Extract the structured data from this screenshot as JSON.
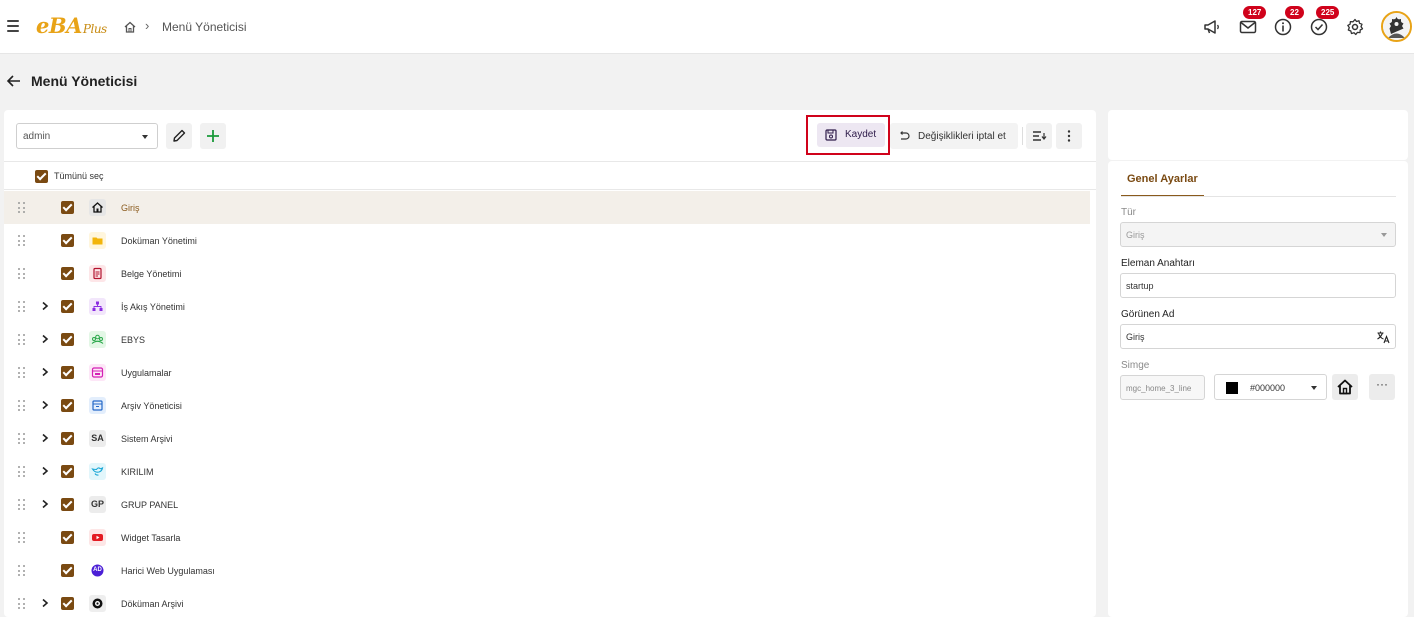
{
  "topbar": {
    "logo_text": "eBA",
    "logo_plus": "Plus",
    "breadcrumb": "Menü Yöneticisi",
    "badges": {
      "mail": "127",
      "info": "22",
      "tasks": "225"
    }
  },
  "page": {
    "title": "Menü Yöneticisi"
  },
  "toolbar": {
    "user_select": "admin",
    "save_label": "Kaydet",
    "cancel_label": "Değişiklikleri iptal et"
  },
  "tree": {
    "select_all_label": "Tümünü seç",
    "items": [
      {
        "label": "Giriş",
        "icon": "home-icon",
        "expandable": false,
        "selected": true
      },
      {
        "label": "Doküman Yönetimi",
        "icon": "folder-icon",
        "expandable": false
      },
      {
        "label": "Belge Yönetimi",
        "icon": "document-icon",
        "expandable": false
      },
      {
        "label": "İş Akış Yönetimi",
        "icon": "workflow-icon",
        "expandable": true
      },
      {
        "label": "EBYS",
        "icon": "group-icon",
        "expandable": true
      },
      {
        "label": "Uygulamalar",
        "icon": "app-window-icon",
        "expandable": true
      },
      {
        "label": "Arşiv Yöneticisi",
        "icon": "archive-icon",
        "expandable": true
      },
      {
        "label": "Sistem Arşivi",
        "icon_text": "SA",
        "expandable": true
      },
      {
        "label": "KIRILIM",
        "icon": "bird-icon",
        "expandable": true
      },
      {
        "label": "GRUP PANEL",
        "icon_text": "GP",
        "expandable": true
      },
      {
        "label": "Widget Tasarla",
        "icon": "youtube-icon",
        "expandable": false
      },
      {
        "label": "Harici Web Uygulaması",
        "icon_text": "AD",
        "expandable": false
      },
      {
        "label": "Döküman Arşivi",
        "icon": "target-icon",
        "expandable": true
      }
    ]
  },
  "settings": {
    "tab_label": "Genel Ayarlar",
    "type_label": "Tür",
    "type_value": "Giriş",
    "key_label": "Eleman Anahtarı",
    "key_value": "startup",
    "display_name_label": "Görünen Ad",
    "display_name_value": "Giriş",
    "icon_label": "Simge",
    "icon_value": "mgc_home_3_line",
    "color_value": "#000000",
    "more_label": "···"
  },
  "colors": {
    "accent": "#7a4a12",
    "highlight": "#d0021b",
    "brand": "#e8a317"
  }
}
